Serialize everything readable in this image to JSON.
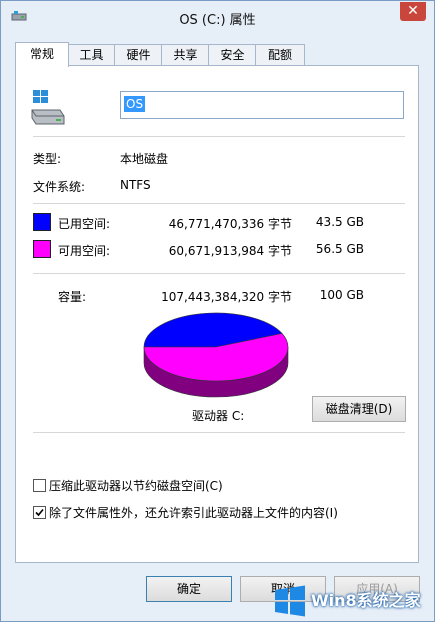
{
  "window": {
    "title": "OS (C:) 属性",
    "close_label": "✕"
  },
  "tabs": [
    "常规",
    "工具",
    "硬件",
    "共享",
    "安全",
    "配额"
  ],
  "general": {
    "drive_name": "OS",
    "type_label": "类型:",
    "type_value": "本地磁盘",
    "fs_label": "文件系统:",
    "fs_value": "NTFS"
  },
  "space": {
    "used": {
      "label": "已用空间:",
      "bytes": "46,771,470,336 字节",
      "size": "43.5 GB",
      "color": "#0000ff"
    },
    "free": {
      "label": "可用空间:",
      "bytes": "60,671,913,984 字节",
      "size": "56.5 GB",
      "color": "#ff00ff"
    },
    "capacity": {
      "label": "容量:",
      "bytes": "107,443,384,320 字节",
      "size": "100 GB"
    },
    "used_fraction": 0.435
  },
  "drive_label": "驱动器 C:",
  "cleanup_button": "磁盘清理(D)",
  "options": [
    {
      "label": "压缩此驱动器以节约磁盘空间(C)",
      "checked": false
    },
    {
      "label": "除了文件属性外，还允许索引此驱动器上文件的内容(I)",
      "checked": true
    }
  ],
  "buttons": {
    "ok": "确定",
    "cancel": "取消",
    "apply": "应用(A)"
  },
  "watermark": "Win8系统之家"
}
